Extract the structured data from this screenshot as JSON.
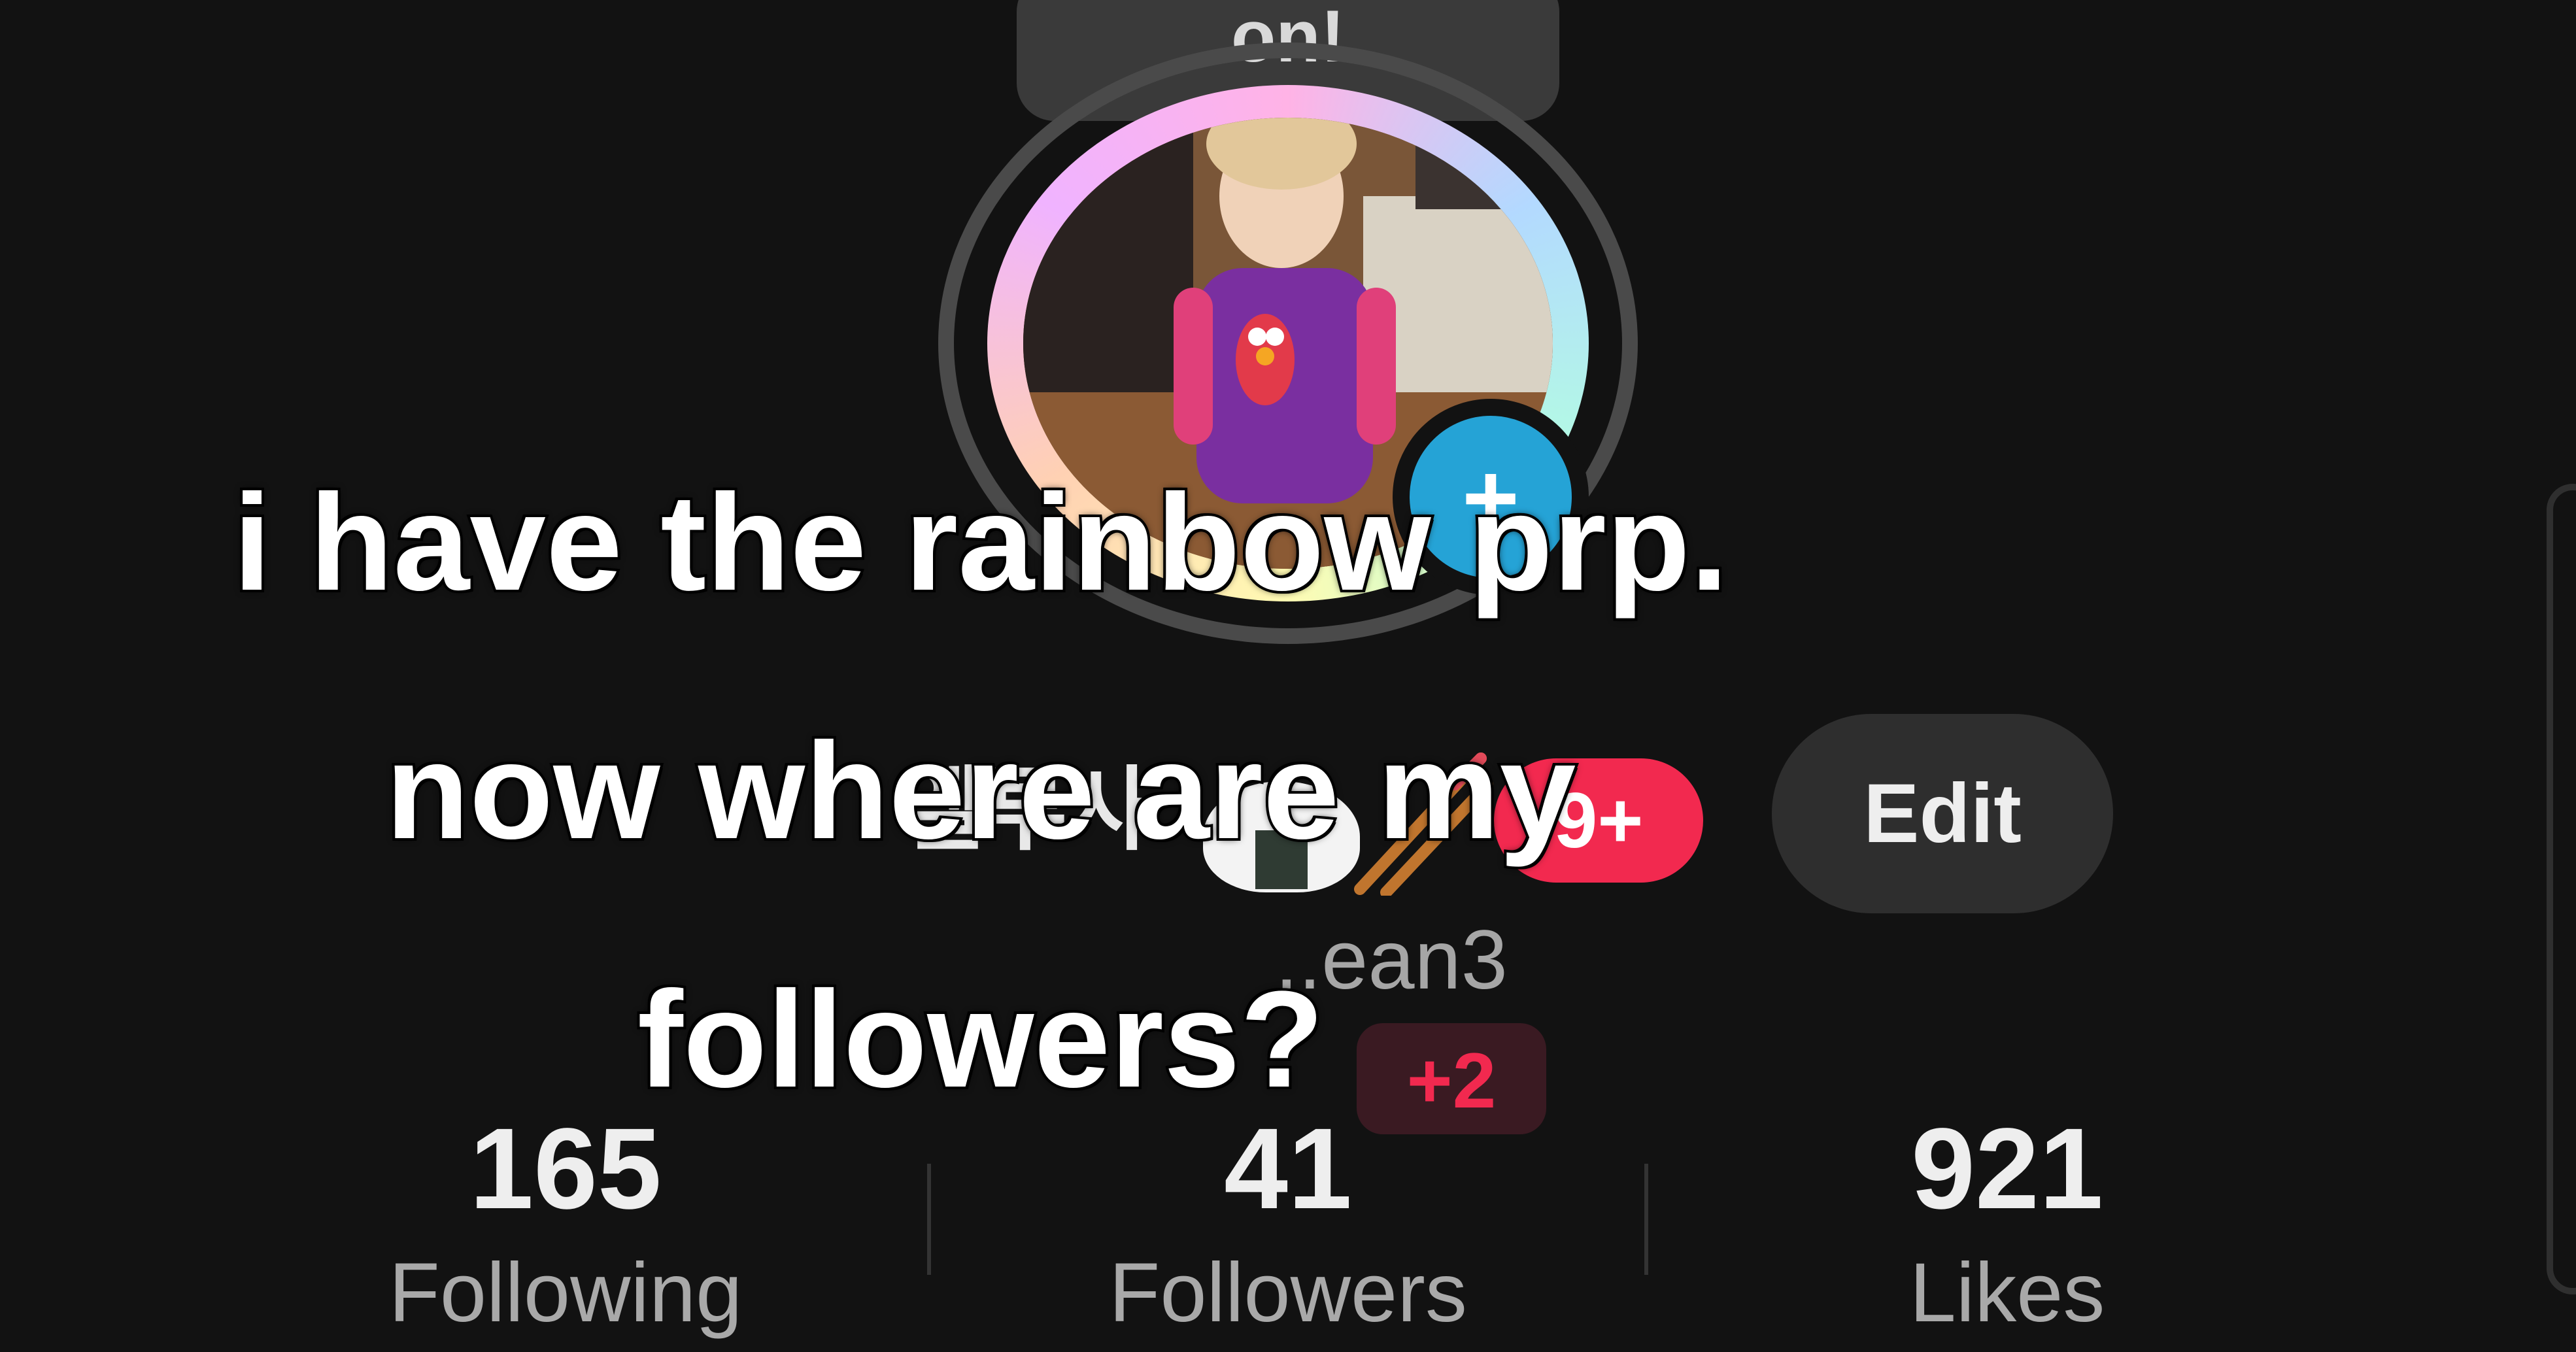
{
  "bubble": {
    "text": "on!"
  },
  "profile": {
    "display_name": "엘루사",
    "level_badge": "9+",
    "username": "..ean3",
    "new_followers": "+2",
    "edit_label": "Edit"
  },
  "stats": [
    {
      "value": "165",
      "label": "Following"
    },
    {
      "value": "41",
      "label": "Followers"
    },
    {
      "value": "921",
      "label": "Likes"
    }
  ],
  "caption": {
    "lines": [
      "i have the rainbow prp.",
      "now where are my",
      "followers?"
    ]
  },
  "icons": {
    "avatar_badge": "plus-icon",
    "emoji_1": "rice-ball-icon",
    "emoji_2": "chopsticks-icon"
  },
  "colors": {
    "background": "#121212",
    "accent_red": "#f2294f",
    "badge_blue": "#25a3d6",
    "edit_button": "#2e2e2e"
  }
}
